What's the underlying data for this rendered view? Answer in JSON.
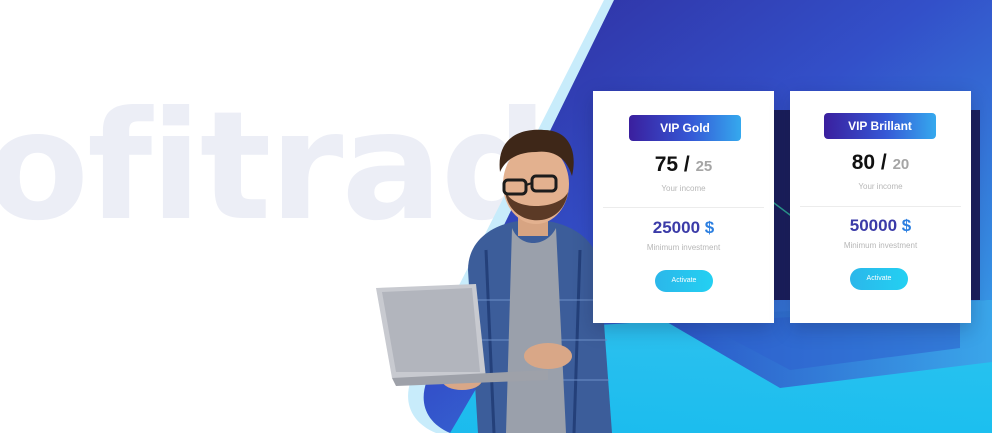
{
  "watermark": {
    "text": "ofitrade"
  },
  "plans": [
    {
      "name": "VIP Gold",
      "income_main": "75 /",
      "income_sub": "25",
      "income_caption": "Your income",
      "investment": "25000",
      "currency": "$",
      "investment_caption": "Minimum investment",
      "action": "Activate"
    },
    {
      "name": "VIP Brillant",
      "income_main": "80 /",
      "income_sub": "20",
      "income_caption": "Your income",
      "investment": "50000",
      "currency": "$",
      "investment_caption": "Minimum investment",
      "action": "Activate"
    }
  ],
  "colors": {
    "brand_purple": "#3a1f9e",
    "brand_blue": "#3558d6",
    "accent_cyan": "#23d0f2"
  }
}
